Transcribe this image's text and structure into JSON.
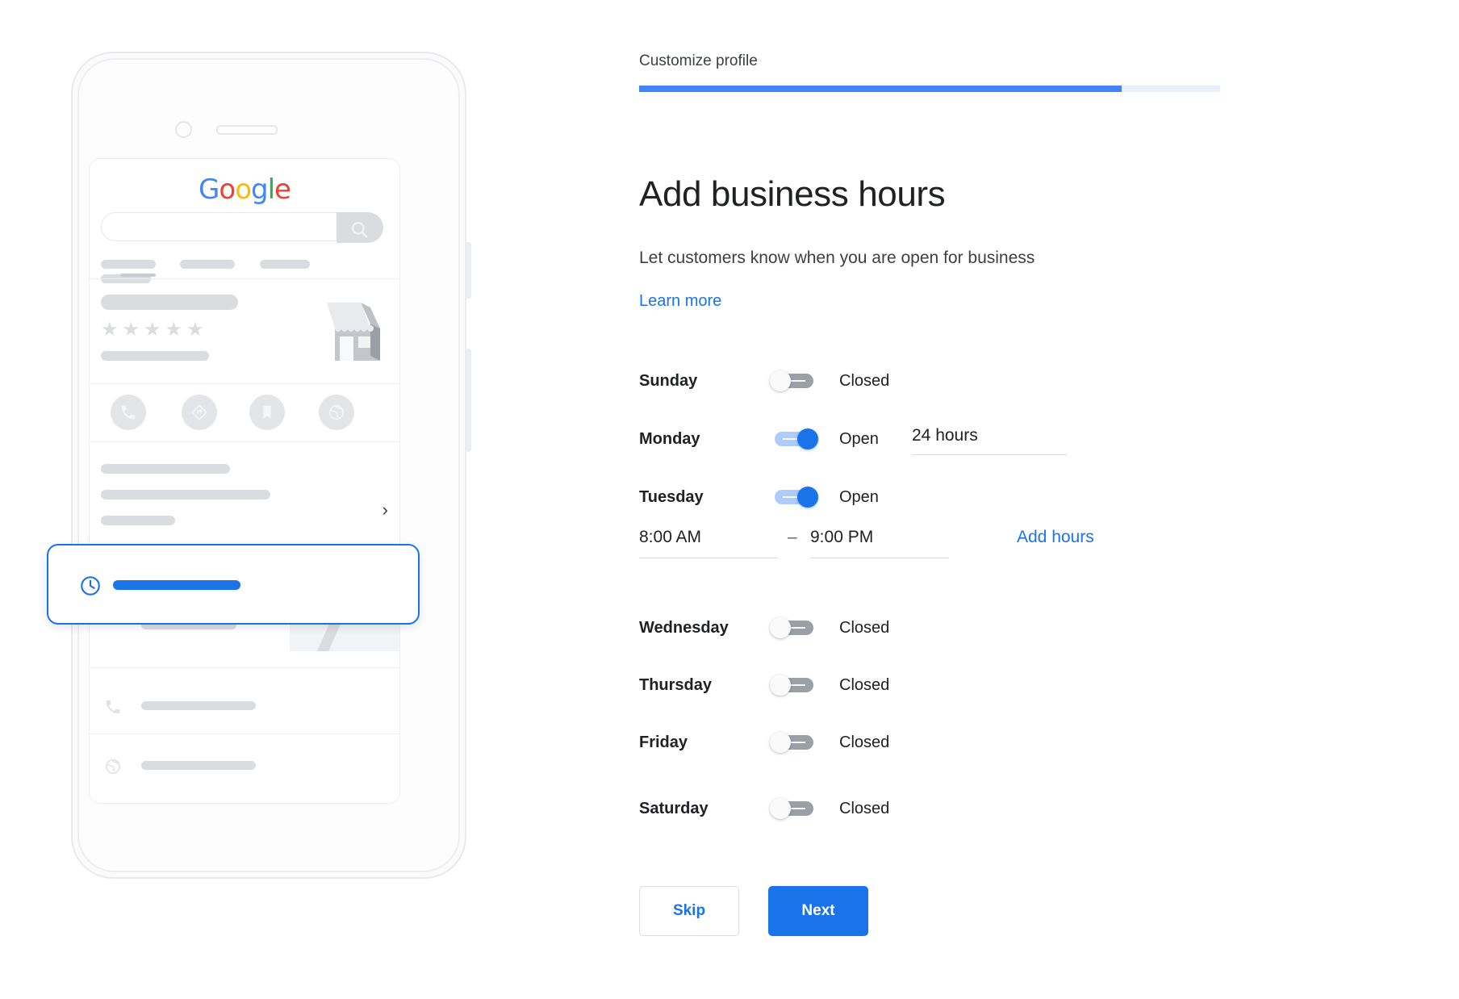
{
  "step": {
    "label": "Customize profile",
    "progress_percent": 83,
    "fill_color": "#4285f4",
    "track_color": "#e8f0fe"
  },
  "page": {
    "title": "Add business hours",
    "subtitle": "Let customers know when you are open for business",
    "learn_more": "Learn more"
  },
  "hours": {
    "days": [
      {
        "name": "Sunday",
        "open": false,
        "state_label": "Closed"
      },
      {
        "name": "Monday",
        "open": true,
        "state_label": "Open",
        "value": "24 hours"
      },
      {
        "name": "Tuesday",
        "open": true,
        "state_label": "Open"
      },
      {
        "name": "Wednesday",
        "open": false,
        "state_label": "Closed"
      },
      {
        "name": "Thursday",
        "open": false,
        "state_label": "Closed"
      },
      {
        "name": "Friday",
        "open": false,
        "state_label": "Closed"
      },
      {
        "name": "Saturday",
        "open": false,
        "state_label": "Closed"
      }
    ],
    "tuesday_times": {
      "start": "8:00 AM",
      "dash": "–",
      "end": "9:00 PM",
      "add_hours": "Add hours"
    }
  },
  "footer": {
    "skip_label": "Skip",
    "next_label": "Next"
  },
  "preview": {
    "logo": {
      "g1": "G",
      "o1": "o",
      "o2": "o",
      "g2": "g",
      "l": "l",
      "e": "e"
    },
    "colors": {
      "blue": "#4285F4",
      "red": "#EA4335",
      "yellow": "#FBBC05",
      "green": "#34A853",
      "accent": "#1a73e8",
      "placeholder": "#dadce0"
    },
    "stars": "★★★★★"
  }
}
